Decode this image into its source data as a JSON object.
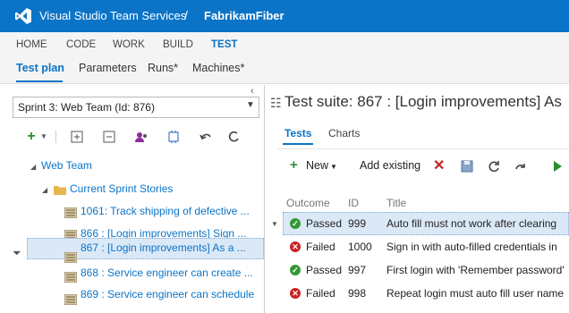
{
  "header": {
    "product_name": "Visual Studio Team Services",
    "separator": "/",
    "project_name": "FabrikamFiber"
  },
  "hub_nav": [
    {
      "label": "HOME"
    },
    {
      "label": "CODE"
    },
    {
      "label": "WORK"
    },
    {
      "label": "BUILD"
    },
    {
      "label": "TEST",
      "active": true
    }
  ],
  "sub_nav": [
    {
      "label": "Test plan",
      "active": true
    },
    {
      "label": "Parameters"
    },
    {
      "label": "Runs*"
    },
    {
      "label": "Machines*"
    }
  ],
  "left": {
    "plan_select_value": "Sprint 3: Web Team (Id: 876)",
    "toolbar_icons": [
      "new-suite-icon",
      "dropdown-icon",
      "expand-all-icon",
      "collapse-all-icon",
      "assign-testers-icon",
      "configurations-icon",
      "back-icon"
    ],
    "tree": {
      "root": "Web Team",
      "folder": "Current Sprint Stories",
      "items": [
        {
          "label": "1061: Track shipping of defective ..."
        },
        {
          "label": "866 : [Login improvements] Sign ..."
        },
        {
          "label": "867 : [Login improvements] As a ...",
          "selected": true
        },
        {
          "label": "868 : Service engineer can create ..."
        },
        {
          "label": "869 : Service engineer can schedule ..."
        }
      ]
    }
  },
  "right": {
    "suite_title": "Test suite: 867 : [Login improvements] As",
    "tabs": [
      {
        "label": "Tests",
        "active": true
      },
      {
        "label": "Charts"
      }
    ],
    "toolbar": {
      "new_label": "New",
      "add_existing_label": "Add existing"
    },
    "columns": {
      "outcome": "Outcome",
      "id": "ID",
      "title": "Title"
    },
    "rows": [
      {
        "outcome": "Passed",
        "id": "999",
        "title": "Auto fill must not work after clearing",
        "selected": true
      },
      {
        "outcome": "Failed",
        "id": "1000",
        "title": "Sign in with auto-filled credentials in"
      },
      {
        "outcome": "Passed",
        "id": "997",
        "title": "First login with 'Remember password'"
      },
      {
        "outcome": "Failed",
        "id": "998",
        "title": "Repeat login must auto fill user name"
      }
    ]
  },
  "colors": {
    "accent": "#0b74c7",
    "passed": "#339933",
    "failed": "#cc2222",
    "selection": "#dbe9f7"
  }
}
